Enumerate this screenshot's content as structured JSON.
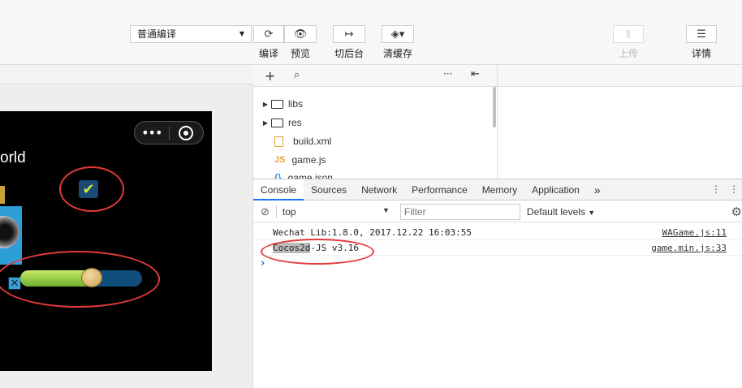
{
  "toolbar": {
    "mode_select": "普通编译",
    "compile_label": "编译",
    "preview_label": "预览",
    "background_label": "切后台",
    "clear_cache_label": "清缓存",
    "upload_label": "上传",
    "details_label": "详情"
  },
  "simulator": {
    "hello_text": "orld",
    "capsule_dots": "•••",
    "checkbox_mark": "✔",
    "close_mark": "✕",
    "slider_fraction": 0.5
  },
  "files": {
    "items": [
      {
        "name": "libs",
        "type": "folder"
      },
      {
        "name": "res",
        "type": "folder"
      },
      {
        "name": "build.xml",
        "type": "file"
      },
      {
        "name": "game.js",
        "type": "js"
      },
      {
        "name": "game.json",
        "type": "json"
      }
    ]
  },
  "devtools": {
    "tabs": [
      "Console",
      "Sources",
      "Network",
      "Performance",
      "Memory",
      "Application"
    ],
    "more": "»",
    "context": "top",
    "filter_placeholder": "Filter",
    "levels": "Default levels",
    "logs": [
      {
        "msg_pre": "",
        "msg_hl": "",
        "msg": "Wechat Lib:1.8.0, 2017.12.22 16:03:55",
        "source": "WAGame.js:11"
      },
      {
        "msg_pre": "",
        "msg_hl": "Cocos2d",
        "msg": "-JS v3.16",
        "source": "game.min.js:33"
      }
    ],
    "prompt": "›"
  },
  "colors": {
    "annotation": "#e23b3b",
    "accent": "#1a73e8"
  }
}
